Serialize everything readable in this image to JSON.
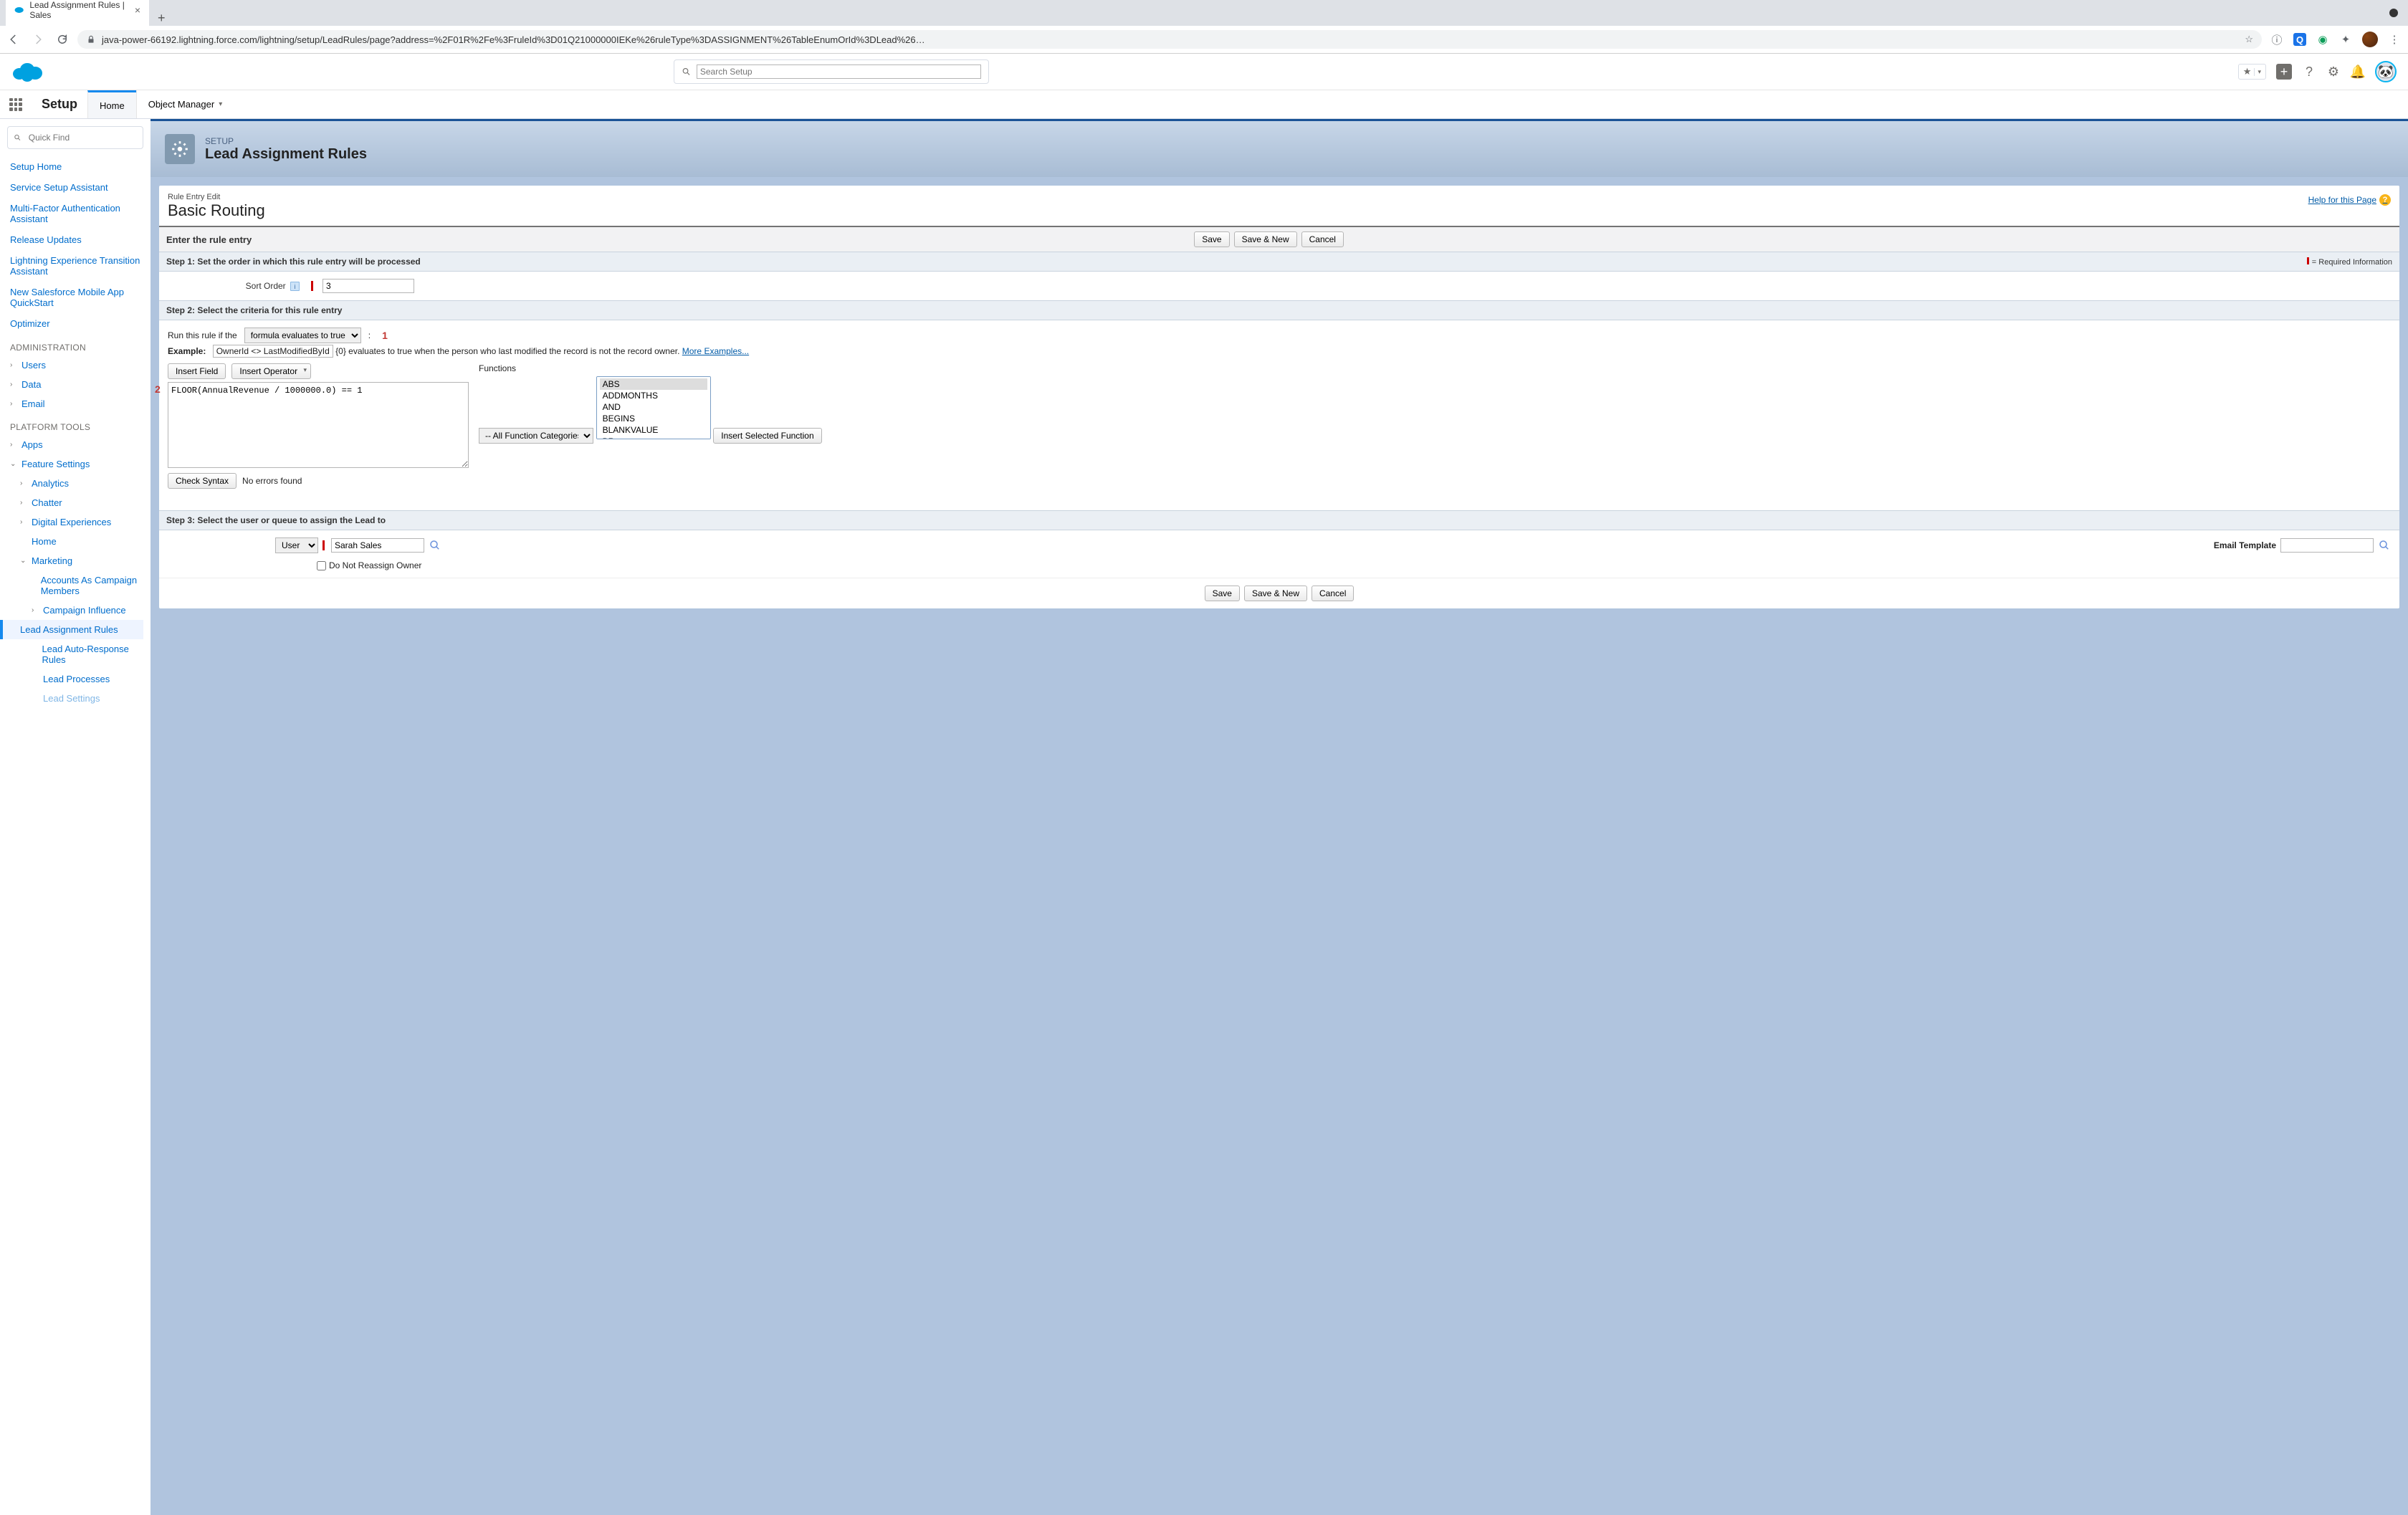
{
  "browser": {
    "tab_title": "Lead Assignment Rules | Sales",
    "url": "java-power-66192.lightning.force.com/lightning/setup/LeadRules/page?address=%2F01R%2Fe%3FruleId%3D01Q21000000IEKe%26ruleType%3DASSIGNMENT%26TableEnumOrId%3DLead%26…"
  },
  "sf_header": {
    "search_placeholder": "Search Setup"
  },
  "context": {
    "app": "Setup",
    "home": "Home",
    "om": "Object Manager"
  },
  "sidebar": {
    "quick_find": "Quick Find",
    "items_top": [
      "Setup Home",
      "Service Setup Assistant",
      "Multi-Factor Authentication Assistant",
      "Release Updates",
      "Lightning Experience Transition Assistant",
      "New Salesforce Mobile App QuickStart",
      "Optimizer"
    ],
    "section_admin": "ADMINISTRATION",
    "admin_items": [
      "Users",
      "Data",
      "Email"
    ],
    "section_platform": "PLATFORM TOOLS",
    "apps": "Apps",
    "feature_settings": "Feature Settings",
    "fs_children": [
      "Analytics",
      "Chatter",
      "Digital Experiences",
      "Home"
    ],
    "marketing": "Marketing",
    "marketing_children": [
      "Accounts As Campaign Members",
      "Campaign Influence",
      "Lead Assignment Rules",
      "Lead Auto-Response Rules",
      "Lead Processes",
      "Lead Settings"
    ]
  },
  "header": {
    "eyebrow": "SETUP",
    "title": "Lead Assignment Rules"
  },
  "panel": {
    "mini": "Rule Entry Edit",
    "title": "Basic Routing",
    "help": "Help for this Page"
  },
  "sec_enter": "Enter the rule entry",
  "btns": {
    "save": "Save",
    "save_new": "Save & New",
    "cancel": "Cancel"
  },
  "step1": {
    "title": "Step 1: Set the order in which this rule entry will be processed",
    "req": "= Required Information",
    "label": "Sort Order",
    "value": "3"
  },
  "step2": {
    "title": "Step 2: Select the criteria for this rule entry",
    "run_label": "Run this rule if the",
    "run_select": "formula evaluates to true",
    "callout1": "1",
    "example_label": "Example:",
    "example_box": "OwnerId <> LastModifiedById",
    "example_text": " {0} evaluates to true when the person who last modified the record is not the record owner.  ",
    "more": "More Examples...",
    "insert_field": "Insert Field",
    "insert_op": "Insert Operator",
    "callout2": "2",
    "formula": "FLOOR(AnnualRevenue / 1000000.0) == 1",
    "check_syntax": "Check Syntax",
    "syntax_result": "No errors found",
    "functions_label": "Functions",
    "fn_cat": "-- All Function Categories --",
    "fn_list": [
      "ABS",
      "ADDMONTHS",
      "AND",
      "BEGINS",
      "BLANKVALUE",
      "BR"
    ],
    "insert_fn": "Insert Selected Function"
  },
  "step3": {
    "title": "Step 3: Select the user or queue to assign the Lead to",
    "type": "User",
    "assignee": "Sarah Sales",
    "email_tpl_label": "Email Template",
    "dno": "Do Not Reassign Owner"
  }
}
